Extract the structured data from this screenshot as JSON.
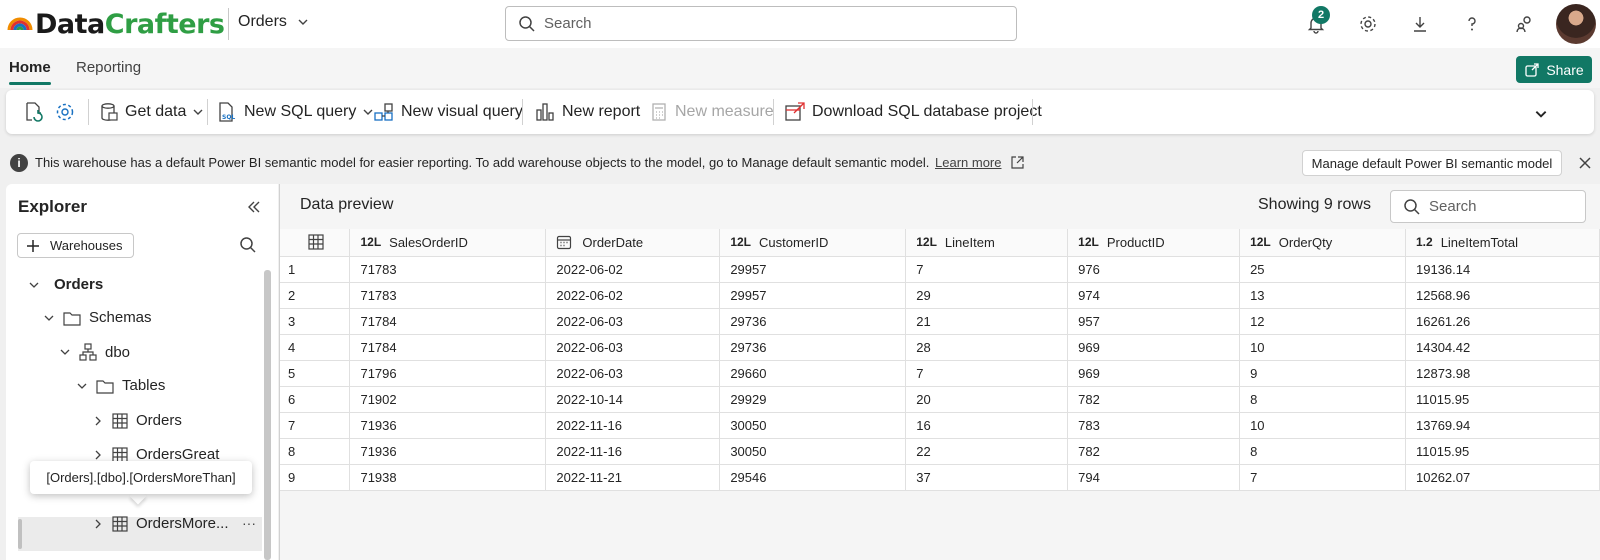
{
  "app": {
    "brand_part1": "Data",
    "brand_part2": "Crafters",
    "workspace": "Orders",
    "search_placeholder": "Search",
    "notification_count": "2"
  },
  "tabs": [
    {
      "label": "Home",
      "active": true
    },
    {
      "label": "Reporting",
      "active": false
    }
  ],
  "share_label": "Share",
  "ribbon": {
    "get_data": "Get data",
    "new_sql_query": "New SQL query",
    "new_visual_query": "New visual query",
    "new_report": "New report",
    "new_measure": "New measure",
    "download_project": "Download SQL database project"
  },
  "info": {
    "text": "This warehouse has a default Power BI semantic model for easier reporting. To add warehouse objects to the model, go to Manage default semantic model.",
    "link": "Learn more",
    "manage_button": "Manage default Power BI semantic model"
  },
  "explorer": {
    "title": "Explorer",
    "warehouses_button": "Warehouses",
    "tree": {
      "root": "Orders",
      "schemas": "Schemas",
      "dbo": "dbo",
      "tables": "Tables",
      "table1": "Orders",
      "table2": "OrdersGreat",
      "table3": "OrdersMore..."
    },
    "tooltip": "[Orders].[dbo].[OrdersMoreThan]"
  },
  "preview": {
    "title": "Data preview",
    "showing": "Showing 9 rows",
    "search_placeholder": "Search",
    "columns": [
      {
        "type": "12L",
        "name": "SalesOrderID"
      },
      {
        "type": "calendar",
        "name": "OrderDate"
      },
      {
        "type": "12L",
        "name": "CustomerID"
      },
      {
        "type": "12L",
        "name": "LineItem"
      },
      {
        "type": "12L",
        "name": "ProductID"
      },
      {
        "type": "12L",
        "name": "OrderQty"
      },
      {
        "type": "1.2",
        "name": "LineItemTotal"
      }
    ],
    "rows": [
      [
        "1",
        "71783",
        "2022-06-02",
        "29957",
        "7",
        "976",
        "25",
        "19136.14"
      ],
      [
        "2",
        "71783",
        "2022-06-02",
        "29957",
        "29",
        "974",
        "13",
        "12568.96"
      ],
      [
        "3",
        "71784",
        "2022-06-03",
        "29736",
        "21",
        "957",
        "12",
        "16261.26"
      ],
      [
        "4",
        "71784",
        "2022-06-03",
        "29736",
        "28",
        "969",
        "10",
        "14304.42"
      ],
      [
        "5",
        "71796",
        "2022-06-03",
        "29660",
        "7",
        "969",
        "9",
        "12873.98"
      ],
      [
        "6",
        "71902",
        "2022-10-14",
        "29929",
        "20",
        "782",
        "8",
        "11015.95"
      ],
      [
        "7",
        "71936",
        "2022-11-16",
        "30050",
        "16",
        "783",
        "10",
        "13769.94"
      ],
      [
        "8",
        "71936",
        "2022-11-16",
        "30050",
        "22",
        "782",
        "8",
        "11015.95"
      ],
      [
        "9",
        "71938",
        "2022-11-21",
        "29546",
        "37",
        "794",
        "7",
        "10262.07"
      ]
    ]
  },
  "colors": {
    "accent": "#117865",
    "brand_green": "#2f9e44"
  }
}
